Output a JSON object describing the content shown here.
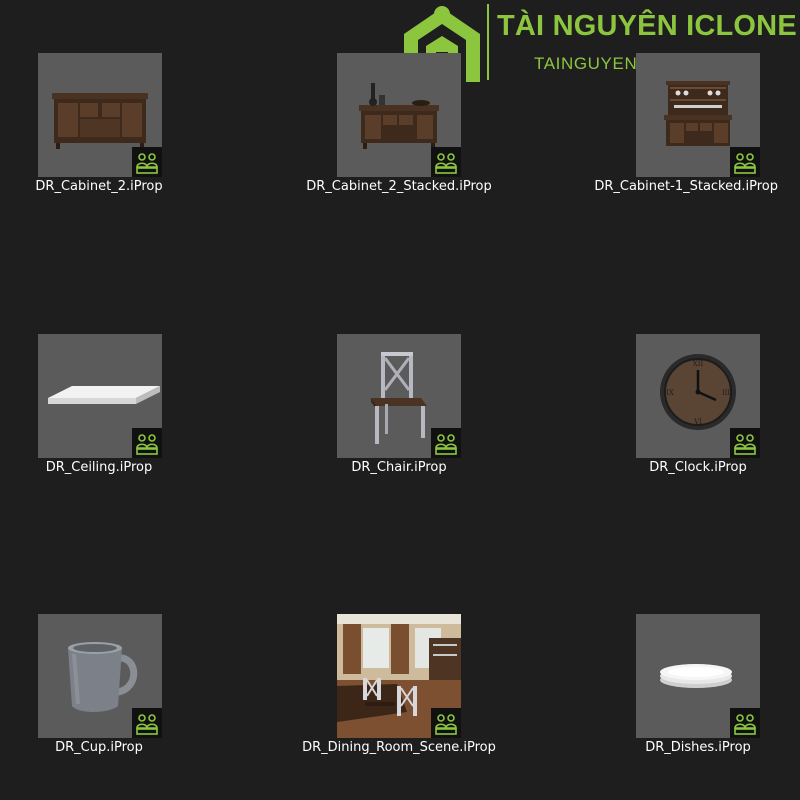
{
  "watermark": {
    "title": "TÀI NGUYÊN ICLONE",
    "url": "TAINGUYENICLONE.COM",
    "color": "#8cc63f"
  },
  "badge_icon": "iprop-group-icon",
  "items": [
    {
      "label": "DR_Cabinet_2.iProp",
      "thumb": "cabinet"
    },
    {
      "label": "DR_Cabinet_2_Stacked.iProp",
      "thumb": "cabinet-stacked"
    },
    {
      "label": "DR_Cabinet-1_Stacked.iProp",
      "thumb": "hutch"
    },
    {
      "label": "DR_Ceiling.iProp",
      "thumb": "ceiling"
    },
    {
      "label": "DR_Chair.iProp",
      "thumb": "chair"
    },
    {
      "label": "DR_Clock.iProp",
      "thumb": "clock"
    },
    {
      "label": "DR_Cup.iProp",
      "thumb": "cup"
    },
    {
      "label": "DR_Dining_Room_Scene.iProp",
      "thumb": "scene"
    },
    {
      "label": "DR_Dishes.iProp",
      "thumb": "dishes"
    }
  ]
}
